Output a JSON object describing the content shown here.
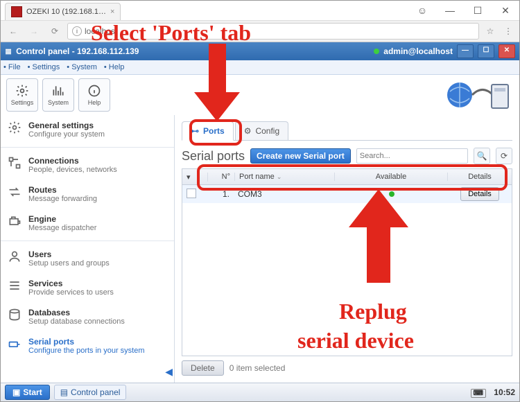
{
  "browser": {
    "tab_title": "OZEKI 10 (192.168.1…",
    "address": "localhost",
    "win_min": "—",
    "win_max": "☐",
    "win_close": "✕",
    "user_icon": "☺"
  },
  "app_header": {
    "icon": "≣",
    "title": "Control panel - 192.168.112.139",
    "user": "admin@localhost",
    "min": "—",
    "max": "☐",
    "close": "✕"
  },
  "menu": {
    "file": "• File",
    "settings": "• Settings",
    "system": "• System",
    "help": "• Help"
  },
  "toolbar": {
    "settings": "Settings",
    "system": "System",
    "help": "Help"
  },
  "sidebar": {
    "items": [
      {
        "label": "General settings",
        "sub": "Configure your system"
      },
      {
        "label": "Connections",
        "sub": "People, devices, networks"
      },
      {
        "label": "Routes",
        "sub": "Message forwarding"
      },
      {
        "label": "Engine",
        "sub": "Message dispatcher"
      },
      {
        "label": "Users",
        "sub": "Setup users and groups"
      },
      {
        "label": "Services",
        "sub": "Provide services to users"
      },
      {
        "label": "Databases",
        "sub": "Setup database connections"
      },
      {
        "label": "Serial ports",
        "sub": "Configure the ports in your system"
      }
    ]
  },
  "tabs": {
    "ports": "Ports",
    "config": "Config"
  },
  "panel": {
    "title": "Serial ports",
    "create": "Create new Serial port",
    "search_placeholder": "Search...",
    "cols": {
      "n": "N°",
      "name": "Port name",
      "available": "Available",
      "details": "Details"
    },
    "row": {
      "n": "1.",
      "name": "COM3",
      "details": "Details"
    },
    "delete": "Delete",
    "selected": "0 item selected"
  },
  "taskbar": {
    "start": "Start",
    "cp": "Control panel",
    "time": "10:52"
  },
  "annotations": {
    "top": "Select 'Ports' tab",
    "bottom1": "Replug",
    "bottom2": "serial device"
  }
}
